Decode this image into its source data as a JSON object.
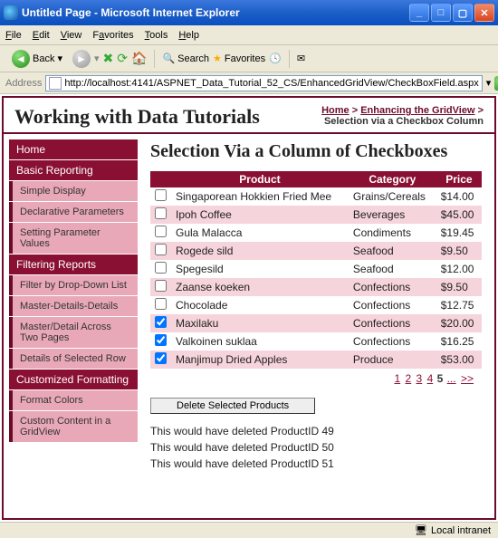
{
  "window": {
    "title": "Untitled Page - Microsoft Internet Explorer"
  },
  "menu": [
    "File",
    "Edit",
    "View",
    "Favorites",
    "Tools",
    "Help"
  ],
  "toolbar": {
    "back": "Back",
    "search": "Search",
    "favorites": "Favorites"
  },
  "address": {
    "label": "Address",
    "url": "http://localhost:4141/ASPNET_Data_Tutorial_52_CS/EnhancedGridView/CheckBoxField.aspx",
    "go": "Go"
  },
  "header": {
    "title": "Working with Data Tutorials",
    "crumbs": [
      "Home",
      "Enhancing the GridView",
      "Selection via a Checkbox Column"
    ]
  },
  "sidebar": [
    {
      "t": "h",
      "label": "Home"
    },
    {
      "t": "h",
      "label": "Basic Reporting"
    },
    {
      "t": "i",
      "label": "Simple Display"
    },
    {
      "t": "i",
      "label": "Declarative Parameters"
    },
    {
      "t": "i",
      "label": "Setting Parameter Values"
    },
    {
      "t": "h",
      "label": "Filtering Reports"
    },
    {
      "t": "i",
      "label": "Filter by Drop-Down List"
    },
    {
      "t": "i",
      "label": "Master-Details-Details"
    },
    {
      "t": "i",
      "label": "Master/Detail Across Two Pages"
    },
    {
      "t": "i",
      "label": "Details of Selected Row"
    },
    {
      "t": "h",
      "label": "Customized Formatting"
    },
    {
      "t": "i",
      "label": "Format Colors"
    },
    {
      "t": "i",
      "label": "Custom Content in a GridView"
    }
  ],
  "page": {
    "heading": "Selection Via a Column of Checkboxes",
    "cols": [
      "Product",
      "Category",
      "Price"
    ],
    "rows": [
      {
        "chk": false,
        "p": "Singaporean Hokkien Fried Mee",
        "c": "Grains/Cereals",
        "pr": "$14.00"
      },
      {
        "chk": false,
        "p": "Ipoh Coffee",
        "c": "Beverages",
        "pr": "$45.00"
      },
      {
        "chk": false,
        "p": "Gula Malacca",
        "c": "Condiments",
        "pr": "$19.45"
      },
      {
        "chk": false,
        "p": "Rogede sild",
        "c": "Seafood",
        "pr": "$9.50"
      },
      {
        "chk": false,
        "p": "Spegesild",
        "c": "Seafood",
        "pr": "$12.00"
      },
      {
        "chk": false,
        "p": "Zaanse koeken",
        "c": "Confections",
        "pr": "$9.50"
      },
      {
        "chk": false,
        "p": "Chocolade",
        "c": "Confections",
        "pr": "$12.75"
      },
      {
        "chk": true,
        "p": "Maxilaku",
        "c": "Confections",
        "pr": "$20.00"
      },
      {
        "chk": true,
        "p": "Valkoinen suklaa",
        "c": "Confections",
        "pr": "$16.25"
      },
      {
        "chk": true,
        "p": "Manjimup Dried Apples",
        "c": "Produce",
        "pr": "$53.00"
      }
    ],
    "pager": {
      "pages": [
        "1",
        "2",
        "3",
        "4",
        "5"
      ],
      "current": "5",
      "more": "...",
      "next": ">>"
    },
    "delete_btn": "Delete Selected Products",
    "messages": [
      "This would have deleted ProductID 49",
      "This would have deleted ProductID 50",
      "This would have deleted ProductID 51"
    ]
  },
  "status": {
    "zone": "Local intranet"
  }
}
